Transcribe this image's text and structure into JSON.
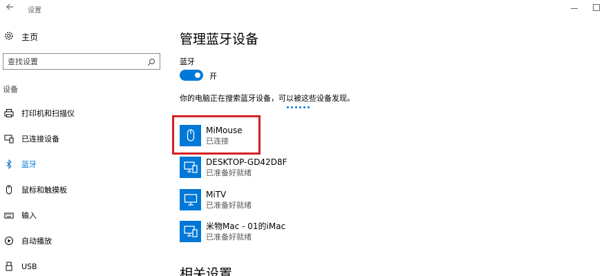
{
  "window": {
    "title": "设置",
    "back_icon": "back-arrow-icon",
    "minimize_icon": "minimize-icon",
    "maximize_icon": "maximize-icon"
  },
  "sidebar": {
    "home_label": "主页",
    "search_placeholder": "查找设置",
    "group_title": "设备",
    "items": [
      {
        "label": "打印机和扫描仪",
        "icon": "printer-icon"
      },
      {
        "label": "已连接设备",
        "icon": "connected-devices-icon"
      },
      {
        "label": "蓝牙",
        "icon": "bluetooth-icon",
        "active": true
      },
      {
        "label": "鼠标和触摸板",
        "icon": "mouse-icon"
      },
      {
        "label": "输入",
        "icon": "keyboard-icon"
      },
      {
        "label": "自动播放",
        "icon": "autoplay-icon"
      },
      {
        "label": "USB",
        "icon": "usb-icon"
      }
    ]
  },
  "main": {
    "title": "管理蓝牙设备",
    "bluetooth_label": "蓝牙",
    "toggle_state": "开",
    "toggle_on": true,
    "discover_text": "你的电脑正在搜索蓝牙设备，可以被这些设备发现。",
    "devices": [
      {
        "name": "MiMouse",
        "status": "已连接",
        "icon": "mouse-device-icon"
      },
      {
        "name": "DESKTOP-GD42D8F",
        "status": "已准备好就绪",
        "icon": "computer-phone-icon"
      },
      {
        "name": "MiTV",
        "status": "已准备好就绪",
        "icon": "monitor-icon"
      },
      {
        "name": "米物Mac - 01的iMac",
        "status": "已准备好就绪",
        "icon": "computer-phone-icon"
      }
    ],
    "related_heading": "相关设置"
  },
  "colors": {
    "accent": "#0078d7",
    "highlight": "#d61f26"
  }
}
